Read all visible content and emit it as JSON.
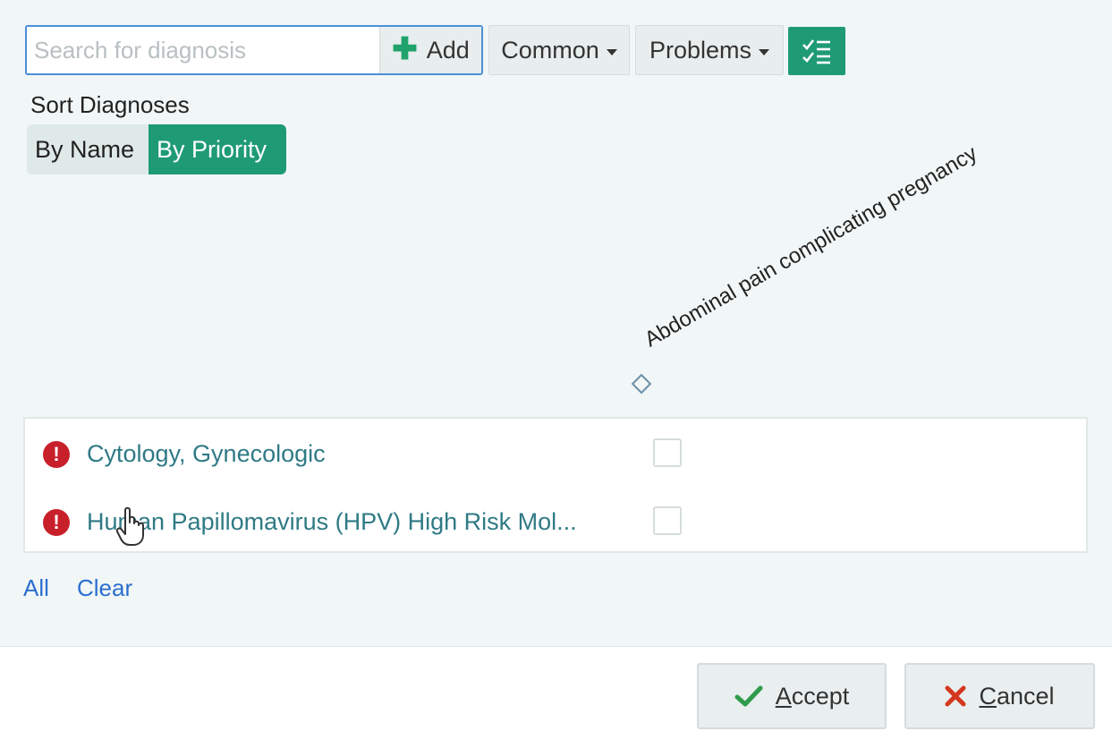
{
  "search": {
    "placeholder": "Search for diagnosis",
    "add_label": "Add"
  },
  "toolbar": {
    "common_label": "Common",
    "problems_label": "Problems"
  },
  "sort": {
    "label": "Sort Diagnoses",
    "by_name": "By Name",
    "by_priority": "By Priority",
    "selected": "By Priority"
  },
  "column_header": "Abdominal pain complicating pregnancy",
  "diagnoses": [
    {
      "name": "Cytology, Gynecologic",
      "checked": false
    },
    {
      "name": "Human Papillomavirus (HPV) High Risk Mol...",
      "checked": false
    }
  ],
  "links": {
    "all": "All",
    "clear": "Clear"
  },
  "footer": {
    "accept_first": "A",
    "accept_rest": "ccept",
    "cancel_first": "C",
    "cancel_rest": "ancel"
  },
  "colors": {
    "accent_green": "#1f9b74",
    "link_blue": "#2a6fd0",
    "alert_red": "#c8202a",
    "diagnosis_teal": "#2f7a85"
  }
}
